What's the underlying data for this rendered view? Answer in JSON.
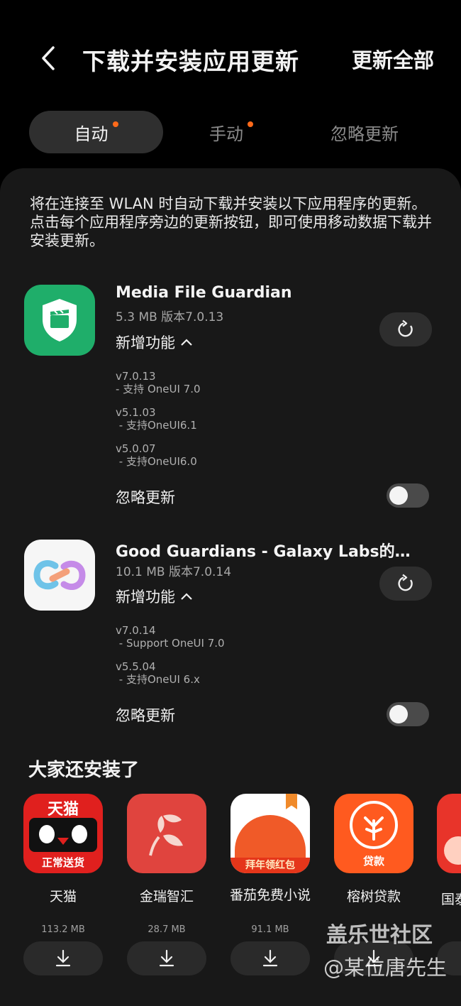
{
  "header": {
    "title": "下载并安装应用更新",
    "update_all": "更新全部"
  },
  "tabs": [
    {
      "label": "自动",
      "has_dot": true,
      "active": true
    },
    {
      "label": "手动",
      "has_dot": true,
      "active": false
    },
    {
      "label": "忽略更新",
      "has_dot": false,
      "active": false
    }
  ],
  "description": "将在连接至 WLAN 时自动下载并安装以下应用程序的更新。点击每个应用程序旁边的更新按钮，即可使用移动数据下载并安装更新。",
  "apps": [
    {
      "name": "Media File Guardian",
      "meta": "5.3 MB  版本7.0.13",
      "whats_new": "新增功能",
      "notes": [
        "v7.0.13\n- 支持 OneUI 7.0",
        "v5.1.03\n - 支持OneUI6.1",
        "v5.0.07\n - 支持OneUI6.0"
      ],
      "ignore_label": "忽略更新",
      "ignore_on": false
    },
    {
      "name": "Good Guardians - Galaxy Labs的…",
      "meta": "10.1 MB  版本7.0.14",
      "whats_new": "新增功能",
      "notes": [
        "v7.0.14\n - Support OneUI 7.0",
        "v5.5.04\n - 支持OneUI 6.x"
      ],
      "ignore_label": "忽略更新",
      "ignore_on": false
    }
  ],
  "recommendations": {
    "title": "大家还安装了",
    "items": [
      {
        "name": "天猫",
        "size": "113.2 MB",
        "icon_text": "天猫",
        "icon_sub": "正常送货"
      },
      {
        "name": "金瑞智汇",
        "size": "28.7 MB"
      },
      {
        "name": "番茄免费小说",
        "size": "91.1 MB",
        "icon_sub": "拜年领红包"
      },
      {
        "name": "榕树贷款",
        "size": "",
        "icon_sub": "贷款"
      },
      {
        "name": "国泰",
        "size": ""
      }
    ]
  },
  "watermark": {
    "line1": "盖乐世社区",
    "line2": "@某位唐先生"
  },
  "colors": {
    "accent_dot": "#ff6a1a",
    "background": "#000000",
    "panel": "#181818"
  }
}
